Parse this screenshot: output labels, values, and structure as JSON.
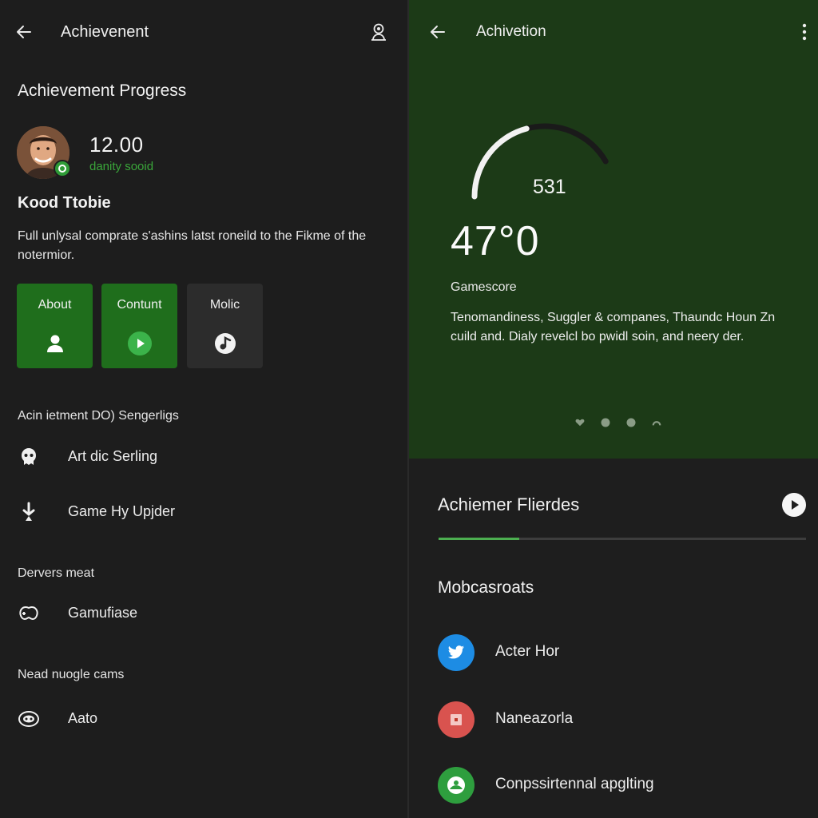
{
  "left": {
    "header": {
      "title": "Achievenent"
    },
    "section_title": "Achievement Progress",
    "profile": {
      "score": "12.00",
      "subtitle": "danity sooid"
    },
    "player_name": "Kood Ttobie",
    "description": "Full unlysal comprate s'ashins latst roneild to the Fikme of the notermior.",
    "tiles": [
      {
        "label": "About",
        "icon": "person-icon"
      },
      {
        "label": "Contunt",
        "icon": "play-icon"
      },
      {
        "label": "Molic",
        "icon": "music-icon"
      }
    ],
    "group1": {
      "heading": "Acin ietment DO) Sengerligs",
      "items": [
        {
          "label": "Art dic Serling",
          "icon": "alien-icon"
        },
        {
          "label": "Game Hy Upjder",
          "icon": "joystick-icon"
        }
      ]
    },
    "group2": {
      "heading": "Dervers meat",
      "items": [
        {
          "label": "Gamufiase",
          "icon": "controller-icon"
        }
      ]
    },
    "group3": {
      "heading": "Nead nuogle cams",
      "items": [
        {
          "label": "Aato",
          "icon": "gamepad-icon"
        }
      ]
    }
  },
  "right": {
    "header": {
      "title": "Achivetion"
    },
    "gauge_value": "531",
    "gauge_fill_fraction": 0.5,
    "big_number": "47°0",
    "gamescore_label": "Gamescore",
    "description": "Tenomandiness, Suggler & companes, Thaundc Houn Zn cuild and. Dialy revelcl bo pwidl soin, and neery der.",
    "carousel_active_index": 0,
    "featured_title": "Achiemer Flierdes",
    "featured_progress_fraction": 0.22,
    "socials_title": "Mobcasroats",
    "socials": [
      {
        "label": "Acter Hor",
        "icon": "twitter-icon",
        "color": "#1d8ce4"
      },
      {
        "label": "Naneazorla",
        "icon": "app-icon",
        "color": "#d9534f"
      },
      {
        "label": "Conpssirtennal apglting",
        "icon": "green-app-icon",
        "color": "#2e9e3e"
      }
    ]
  },
  "colors": {
    "accent_green": "#1f6e1c",
    "hero_green": "#1c3a17",
    "background": "#1d1d1d"
  }
}
